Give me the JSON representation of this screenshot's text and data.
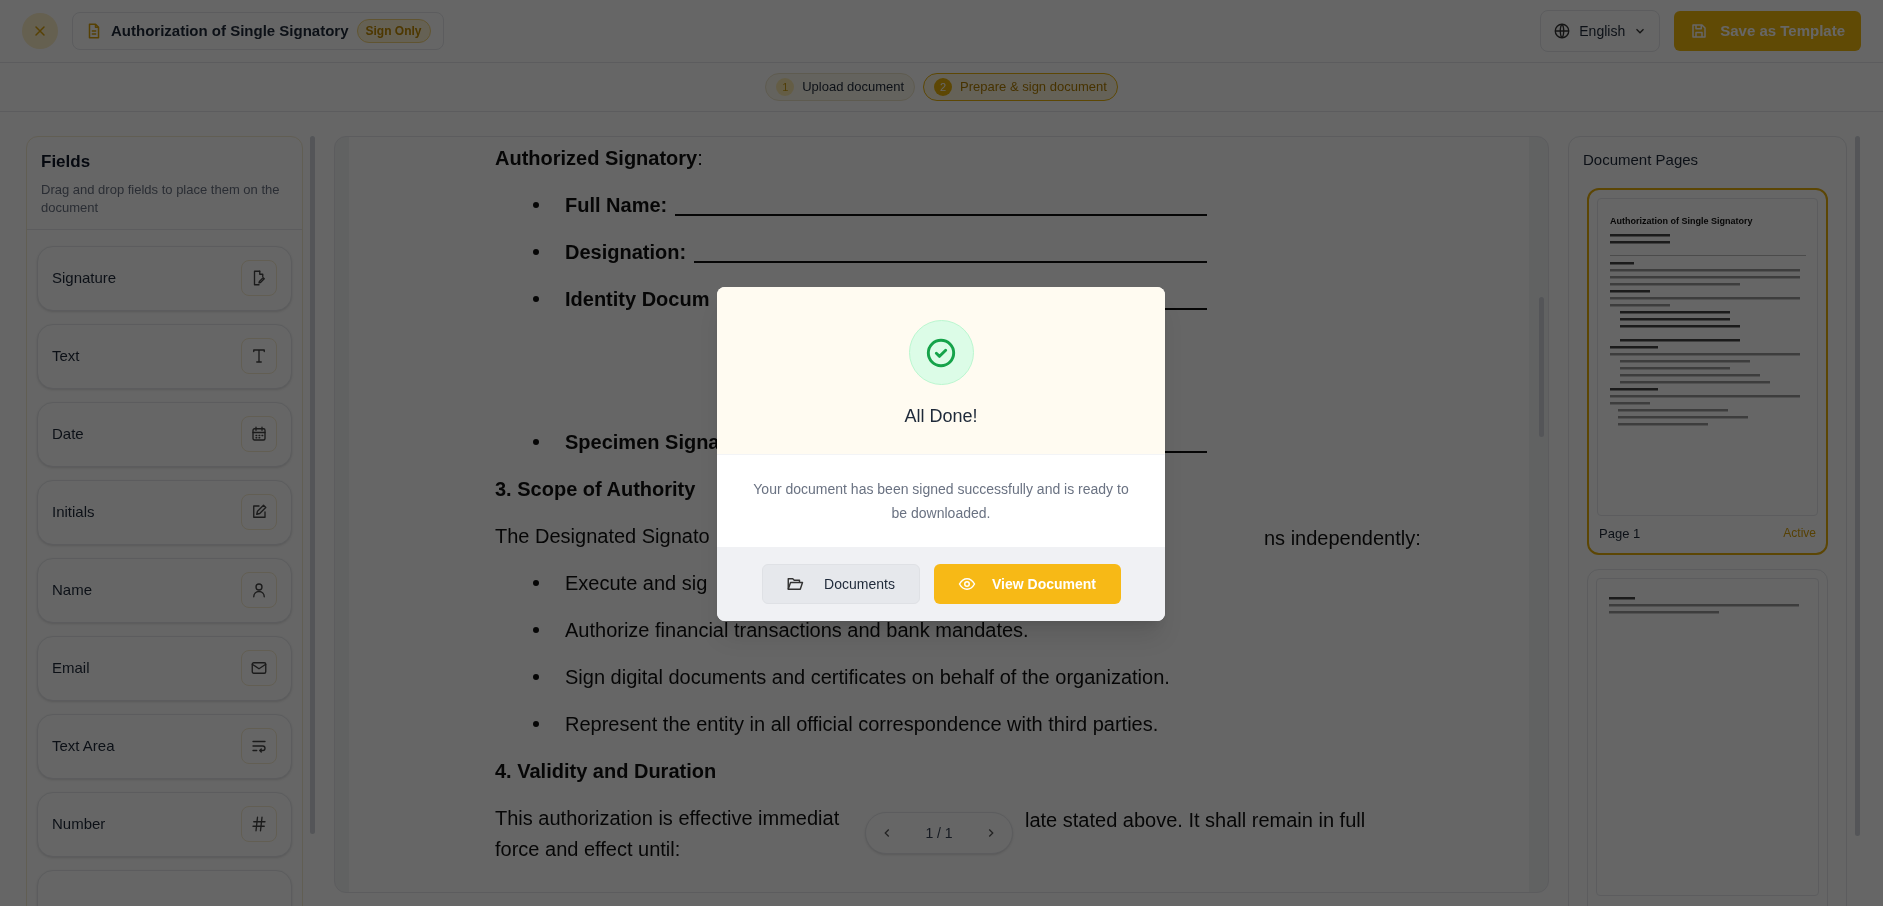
{
  "header": {
    "title": "Authorization of Single Signatory",
    "badge": "Sign Only",
    "language": "English",
    "save_button": "Save as Template"
  },
  "steps": [
    {
      "number": "1",
      "label": "Upload document",
      "selected": false
    },
    {
      "number": "2",
      "label": "Prepare & sign document",
      "selected": true
    }
  ],
  "fields_panel": {
    "title": "Fields",
    "description": "Drag and drop fields to place them on the document",
    "items": [
      {
        "label": "Signature",
        "kind": "signature"
      },
      {
        "label": "Text",
        "kind": "text"
      },
      {
        "label": "Date",
        "kind": "date"
      },
      {
        "label": "Initials",
        "kind": "initials"
      },
      {
        "label": "Name",
        "kind": "name"
      },
      {
        "label": "Email",
        "kind": "email"
      },
      {
        "label": "Text Area",
        "kind": "textarea"
      },
      {
        "label": "Number",
        "kind": "number"
      },
      {
        "kind": "hidden"
      }
    ]
  },
  "document": {
    "lines": [
      {
        "kind": "label",
        "text": "**Authorized Signatory**:"
      },
      {
        "kind": "field",
        "text": "Full Name:"
      },
      {
        "kind": "field",
        "text": "Designation:"
      },
      {
        "kind": "field",
        "text": "Identity Docum"
      },
      {
        "kind": "signature_field",
        "text": "Specimen Signa"
      },
      {
        "kind": "heading",
        "text": "3. Scope of Authority"
      },
      {
        "kind": "para",
        "text": "The Designated Signato",
        "right": "ns independently:"
      },
      {
        "kind": "bullet",
        "text": "Execute and sig"
      },
      {
        "kind": "bullet",
        "text": "Authorize financial transactions and bank mandates."
      },
      {
        "kind": "bullet",
        "text": "Sign digital documents and certificates on behalf of the organization."
      },
      {
        "kind": "bullet",
        "text": "Represent the entity in all official correspondence with third parties."
      },
      {
        "kind": "heading",
        "text": "4. Validity and Duration"
      },
      {
        "kind": "para",
        "text": "This authorization is effective immediat",
        "right": "late stated above. It shall remain in full"
      },
      {
        "kind": "para_cont",
        "text": "force and effect until:"
      }
    ],
    "pager": "1 / 1"
  },
  "pages_panel": {
    "title": "Document Pages",
    "pages": [
      {
        "label": "Page 1",
        "status": "Active",
        "selected": true,
        "title": "Authorization of Single Signatory"
      },
      {
        "selected": false
      }
    ]
  },
  "modal": {
    "title": "All Done!",
    "message": "Your document has been signed successfully and is ready to be downloaded.",
    "buttons": [
      {
        "label": "Documents",
        "kind": "secondary"
      },
      {
        "label": "View Document",
        "kind": "primary"
      }
    ]
  }
}
